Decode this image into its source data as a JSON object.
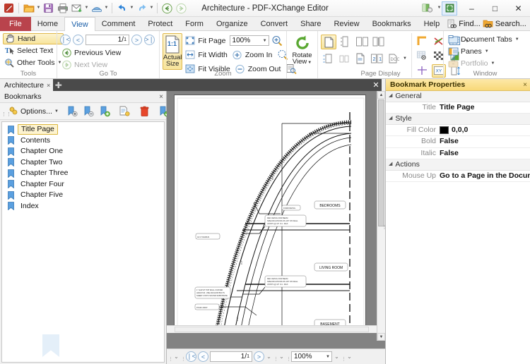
{
  "window": {
    "title": "Architecture - PDF-XChange Editor",
    "minimize": "–",
    "maximize": "□",
    "close": "✕"
  },
  "quick_access": {
    "items": [
      {
        "name": "app-logo-icon",
        "label": "PDF-XChange Editor"
      },
      {
        "name": "open-icon",
        "label": "Open"
      },
      {
        "name": "save-icon",
        "label": "Save"
      },
      {
        "name": "print-icon",
        "label": "Print"
      },
      {
        "name": "email-icon",
        "label": "Email"
      },
      {
        "name": "scan-icon",
        "label": "Scan"
      },
      {
        "name": "undo-icon",
        "label": "Undo"
      },
      {
        "name": "redo-icon",
        "label": "Redo"
      },
      {
        "name": "back-icon",
        "label": "Back"
      },
      {
        "name": "forward-icon",
        "label": "Forward"
      }
    ]
  },
  "ribbon_tabs": {
    "file": "File",
    "items": [
      "Home",
      "View",
      "Comment",
      "Protect",
      "Form",
      "Organize",
      "Convert",
      "Share",
      "Review",
      "Bookmarks",
      "Help"
    ],
    "active": "View",
    "right": [
      {
        "name": "find-button",
        "label": "Find..."
      },
      {
        "name": "search-button",
        "label": "Search..."
      }
    ],
    "collapse": "⌃"
  },
  "ribbon": {
    "groups": [
      {
        "name": "tools",
        "label": "Tools",
        "buttons": [
          {
            "name": "hand-tool",
            "label": "Hand",
            "selected": true
          },
          {
            "name": "select-text-tool",
            "label": "Select Text",
            "selected": false
          },
          {
            "name": "other-tools",
            "label": "Other Tools",
            "dropdown": true
          }
        ]
      },
      {
        "name": "go-to",
        "label": "Go To",
        "page_number": "1/",
        "page_total": "1",
        "buttons": [
          {
            "name": "previous-view",
            "label": "Previous View",
            "disabled": false
          },
          {
            "name": "next-view",
            "label": "Next View",
            "disabled": true
          }
        ]
      },
      {
        "name": "zoom",
        "label": "Zoom",
        "actual_size": "Actual\nSize",
        "actual_size_line1": "Actual",
        "actual_size_line2": "Size",
        "zoom_value": "100%",
        "buttons": [
          {
            "name": "fit-page",
            "label": "Fit Page"
          },
          {
            "name": "fit-width",
            "label": "Fit Width"
          },
          {
            "name": "fit-visible",
            "label": "Fit Visible"
          },
          {
            "name": "zoom-in",
            "label": "Zoom In"
          },
          {
            "name": "zoom-out",
            "label": "Zoom Out"
          }
        ]
      },
      {
        "name": "page-display",
        "label": "Page Display"
      },
      {
        "name": "window",
        "label": "Window",
        "buttons": [
          {
            "name": "document-tabs",
            "label": "Document Tabs",
            "dropdown": true,
            "disabled": false
          },
          {
            "name": "panes",
            "label": "Panes",
            "dropdown": true,
            "disabled": false
          },
          {
            "name": "portfolio",
            "label": "Portfolio",
            "dropdown": true,
            "disabled": true
          }
        ]
      }
    ],
    "rotate_view_line1": "Rotate",
    "rotate_view_line2": "View"
  },
  "document_tabs": {
    "tabs": [
      {
        "label": "Architecture",
        "close": "×"
      }
    ],
    "new_tab": "✚",
    "close_all": "✕"
  },
  "bookmarks_pane": {
    "title": "Bookmarks",
    "close": "×",
    "toolbar": {
      "options_label": "Options...",
      "icons": [
        {
          "name": "new-bookmark-icon"
        },
        {
          "name": "delete-bookmark-icon"
        },
        {
          "name": "add-bookmark-icon"
        },
        {
          "name": "bookmark-properties-icon"
        },
        {
          "name": "delete-icon"
        },
        {
          "name": "validate-bookmark-icon"
        }
      ]
    },
    "items": [
      {
        "label": "Title Page",
        "selected": true
      },
      {
        "label": "Contents",
        "selected": false
      },
      {
        "label": "Chapter One",
        "selected": false
      },
      {
        "label": "Chapter Two",
        "selected": false
      },
      {
        "label": "Chapter Three",
        "selected": false
      },
      {
        "label": "Chapter Four",
        "selected": false
      },
      {
        "label": "Chapter Five",
        "selected": false
      },
      {
        "label": "Index",
        "selected": false
      }
    ]
  },
  "document": {
    "page_labels": [
      "BEDROOMS",
      "LIVING ROOM",
      "BASEMENT"
    ],
    "bottom_bar": {
      "page_number": "1/",
      "page_total": "1",
      "zoom_value": "100%"
    }
  },
  "properties_pane": {
    "title": "Bookmark Properties",
    "close": "×",
    "sections": [
      {
        "name": "general",
        "label": "General",
        "rows": [
          {
            "label": "Title",
            "value": "Title Page"
          }
        ]
      },
      {
        "name": "style",
        "label": "Style",
        "rows": [
          {
            "label": "Fill Color",
            "value": "0,0,0",
            "swatch": "#000000"
          },
          {
            "label": "Bold",
            "value": "False"
          },
          {
            "label": "Italic",
            "value": "False"
          }
        ]
      },
      {
        "name": "actions",
        "label": "Actions",
        "rows": [
          {
            "label": "Mouse Up",
            "value": "Go to a Page in the Docum..",
            "more": "⋯"
          }
        ]
      }
    ]
  },
  "colors": {
    "file_tab": "#b9434c",
    "active_tab_text": "#1b5fa8",
    "properties_header": "#f8d978",
    "selection_highlight": "#fdf3cf",
    "doc_background": "#828282",
    "bookmark_blue": "#4a90d9"
  }
}
